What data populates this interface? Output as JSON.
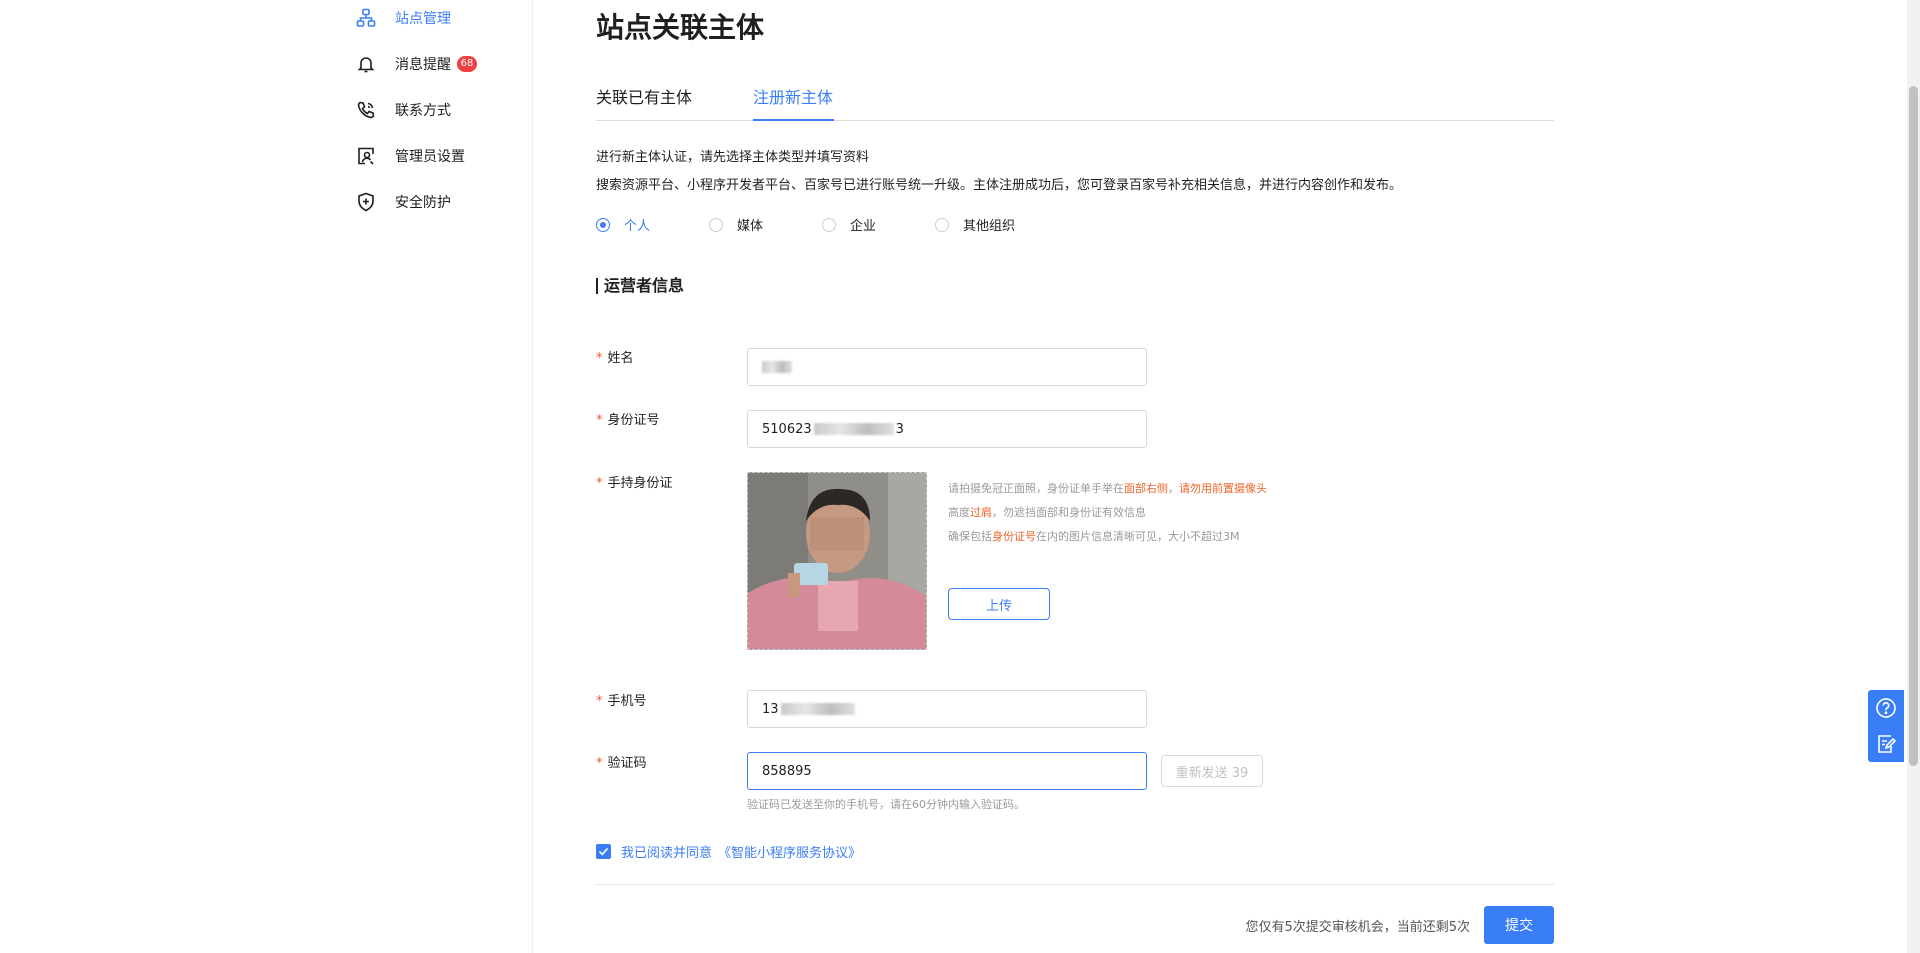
{
  "sidebar": {
    "items": [
      {
        "label": "站点管理",
        "icon": "site-org-icon",
        "active": true
      },
      {
        "label": "消息提醒",
        "icon": "bell-icon",
        "badge": "68"
      },
      {
        "label": "联系方式",
        "icon": "phone-icon"
      },
      {
        "label": "管理员设置",
        "icon": "admin-icon"
      },
      {
        "label": "安全防护",
        "icon": "shield-icon"
      }
    ]
  },
  "page": {
    "title": "站点关联主体",
    "tabs": [
      {
        "label": "关联已有主体",
        "active": false
      },
      {
        "label": "注册新主体",
        "active": true
      }
    ],
    "intro_line1": "进行新主体认证，请先选择主体类型并填写资料",
    "intro_line2": "搜索资源平台、小程序开发者平台、百家号已进行账号统一升级。主体注册成功后，您可登录百家号补充相关信息，并进行内容创作和发布。",
    "entity_types": [
      {
        "label": "个人",
        "checked": true
      },
      {
        "label": "媒体",
        "checked": false
      },
      {
        "label": "企业",
        "checked": false
      },
      {
        "label": "其他组织",
        "checked": false
      }
    ]
  },
  "form": {
    "section_title": "运营者信息",
    "required_mark": "*",
    "name_label": "姓名",
    "name_value_visible": "",
    "id_label": "身份证号",
    "id_value_prefix": "510623",
    "id_value_suffix": "3",
    "photo_label": "手持身份证",
    "tips": {
      "line1_a": "请拍摄免冠正面照，身份证单手举在",
      "line1_hl1": "面部右侧",
      "line1_b": "，",
      "line1_hl2": "请勿用前置摄像头",
      "line2_a": "高度",
      "line2_hl": "过肩",
      "line2_b": "，勿遮挡面部和身份证有效信息",
      "line3_a": "确保包括",
      "line3_hl": "身份证号",
      "line3_b": "在内的图片信息清晰可见，大小不超过3M"
    },
    "upload_label": "上传",
    "phone_label": "手机号",
    "phone_value_prefix": "13",
    "code_label": "验证码",
    "code_value": "858895",
    "resend_label": "重新发送 39",
    "code_tip": "验证码已发送至你的手机号，请在60分钟内输入验证码。"
  },
  "agreement": {
    "checked": true,
    "text": "我已阅读并同意",
    "link": "《智能小程序服务协议》"
  },
  "footer": {
    "note": "您仅有5次提交审核机会，当前还剩5次",
    "submit_label": "提交"
  },
  "float_tools": [
    {
      "icon": "help-icon"
    },
    {
      "icon": "feedback-icon"
    }
  ],
  "colors": {
    "accent": "#3a7ef7",
    "required": "#f0553a",
    "highlight": "#f0632a",
    "badge": "#ef4040"
  }
}
